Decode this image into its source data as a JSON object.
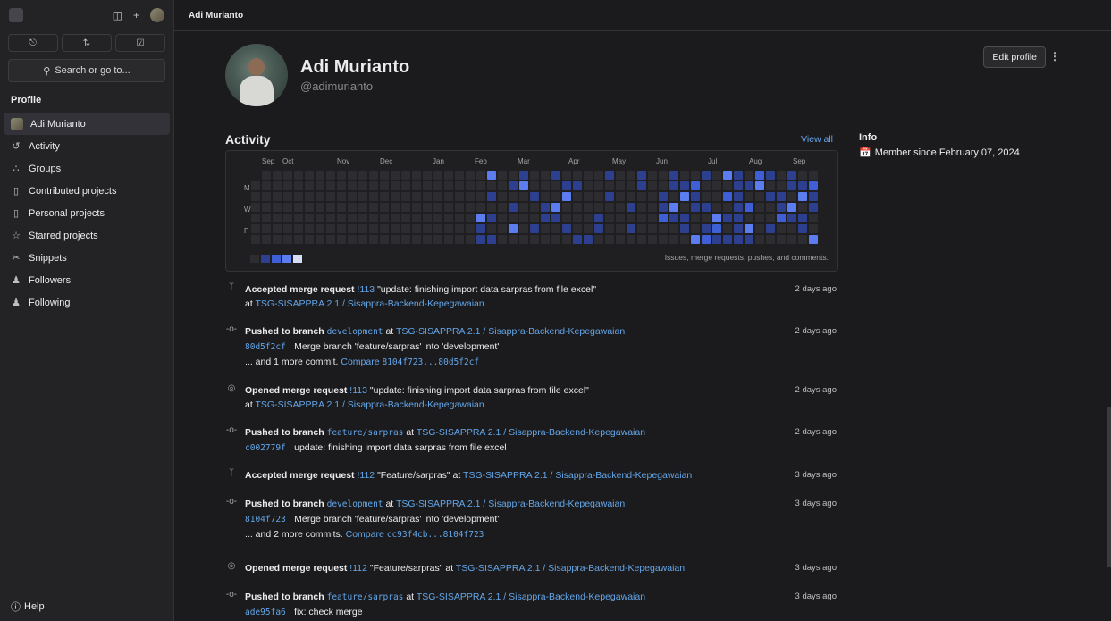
{
  "sidebar": {
    "search_label": "Search or go to...",
    "section_title": "Profile",
    "items": [
      {
        "label": "Adi Murianto",
        "icon": "avatar"
      },
      {
        "label": "Activity",
        "icon": "history-icon"
      },
      {
        "label": "Groups",
        "icon": "group-icon"
      },
      {
        "label": "Contributed projects",
        "icon": "project-icon"
      },
      {
        "label": "Personal projects",
        "icon": "project-icon"
      },
      {
        "label": "Starred projects",
        "icon": "star-icon"
      },
      {
        "label": "Snippets",
        "icon": "snippet-icon"
      },
      {
        "label": "Followers",
        "icon": "users-icon"
      },
      {
        "label": "Following",
        "icon": "users-icon"
      }
    ],
    "help_label": "Help"
  },
  "topbar": {
    "title": "Adi Murianto"
  },
  "profile": {
    "name": "Adi Murianto",
    "handle": "@adimurianto",
    "edit_label": "Edit profile"
  },
  "activity": {
    "title": "Activity",
    "view_all": "View all",
    "months": [
      "Sep",
      "Oct",
      "Nov",
      "Dec",
      "Jan",
      "Feb",
      "Mar",
      "Apr",
      "May",
      "Jun",
      "Jul",
      "Aug",
      "Sep"
    ],
    "day_labels": [
      "M",
      "W",
      "F"
    ],
    "caption": "Issues, merge requests, pushes, and comments.",
    "colors": [
      "#2d2d31",
      "#2d3f8f",
      "#3e5fd6",
      "#5b7df0",
      "#d7dcf7"
    ]
  },
  "events": [
    {
      "icon": "merge-icon",
      "action": "Accepted merge request",
      "ref": "!113",
      "text": "\"update: finishing import data sarpras from file excel\"",
      "line2_pre": "at",
      "project": "TSG-SISAPPRA 2.1 / Sisappra-Backend-Kepegawaian",
      "time": "2 days ago"
    },
    {
      "icon": "commit-icon",
      "action": "Pushed to branch",
      "branch": "development",
      "pre": "at",
      "project": "TSG-SISAPPRA 2.1 / Sisappra-Backend-Kepegawaian",
      "sha": "80d5f2cf",
      "msg": "· Merge branch 'feature/sarpras' into 'development'",
      "more": "... and 1 more commit.",
      "compare_label": "Compare",
      "compare": "8104f723...80d5f2cf",
      "time": "2 days ago"
    },
    {
      "icon": "mr-open-icon",
      "action": "Opened merge request",
      "ref": "!113",
      "text": "\"update: finishing import data sarpras from file excel\"",
      "line2_pre": "at",
      "project": "TSG-SISAPPRA 2.1 / Sisappra-Backend-Kepegawaian",
      "time": "2 days ago"
    },
    {
      "icon": "commit-icon",
      "action": "Pushed to branch",
      "branch": "feature/sarpras",
      "pre": "at",
      "project": "TSG-SISAPPRA 2.1 / Sisappra-Backend-Kepegawaian",
      "sha": "c002779f",
      "msg": "· update: finishing import data sarpras from file excel",
      "time": "2 days ago"
    },
    {
      "icon": "merge-icon",
      "action": "Accepted merge request",
      "ref": "!112",
      "text": "\"Feature/sarpras\" at",
      "project": "TSG-SISAPPRA 2.1 / Sisappra-Backend-Kepegawaian",
      "time": "3 days ago"
    },
    {
      "icon": "commit-icon",
      "action": "Pushed to branch",
      "branch": "development",
      "pre": "at",
      "project": "TSG-SISAPPRA 2.1 / Sisappra-Backend-Kepegawaian",
      "sha": "8104f723",
      "msg": "· Merge branch 'feature/sarpras' into 'development'",
      "more": "... and 2 more commits.",
      "compare_label": "Compare",
      "compare": "cc93f4cb...8104f723",
      "time": "3 days ago"
    },
    {
      "icon": "mr-open-icon",
      "action": "Opened merge request",
      "ref": "!112",
      "text": "\"Feature/sarpras\" at",
      "project": "TSG-SISAPPRA 2.1 / Sisappra-Backend-Kepegawaian",
      "time": "3 days ago"
    },
    {
      "icon": "commit-icon",
      "action": "Pushed to branch",
      "branch": "feature/sarpras",
      "pre": "at",
      "project": "TSG-SISAPPRA 2.1 / Sisappra-Backend-Kepegawaian",
      "sha": "ade95fa6",
      "msg": "· fix: check merge",
      "time": "3 days ago"
    }
  ],
  "info": {
    "title": "Info",
    "member_since": "Member since February 07, 2024"
  }
}
